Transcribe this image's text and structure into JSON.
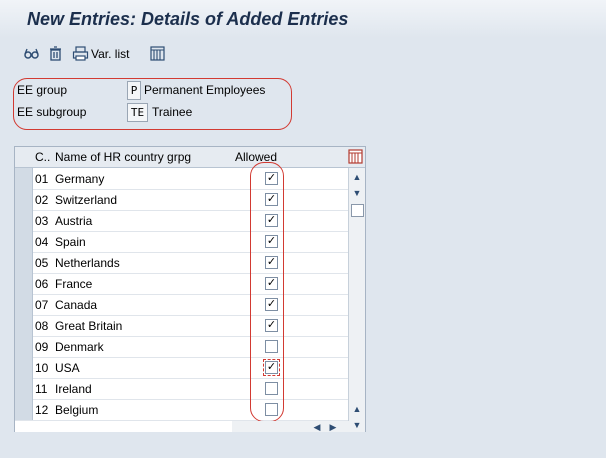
{
  "window": {
    "title": "New Entries: Details of Added Entries"
  },
  "toolbar": {
    "icons": [
      "glasses-icon",
      "trash-icon",
      "printer-icon",
      "table-settings-icon"
    ],
    "var_list_label": "Var. list"
  },
  "header": {
    "ee_group_label": "EE group",
    "ee_group_code": "P",
    "ee_group_text": "Permanent Employees",
    "ee_subgroup_label": "EE subgroup",
    "ee_subgroup_code": "TE",
    "ee_subgroup_text": "Trainee"
  },
  "table": {
    "columns": {
      "code": "C..",
      "name": "Name of HR country grpg",
      "allowed": "Allowed"
    },
    "rows": [
      {
        "code": "01",
        "name": "Germany",
        "allowed": true
      },
      {
        "code": "02",
        "name": "Switzerland",
        "allowed": true
      },
      {
        "code": "03",
        "name": "Austria",
        "allowed": true
      },
      {
        "code": "04",
        "name": "Spain",
        "allowed": true
      },
      {
        "code": "05",
        "name": "Netherlands",
        "allowed": true
      },
      {
        "code": "06",
        "name": "France",
        "allowed": true
      },
      {
        "code": "07",
        "name": "Canada",
        "allowed": true
      },
      {
        "code": "08",
        "name": "Great Britain",
        "allowed": true
      },
      {
        "code": "09",
        "name": "Denmark",
        "allowed": false
      },
      {
        "code": "10",
        "name": "USA",
        "allowed": true
      },
      {
        "code": "11",
        "name": "Ireland",
        "allowed": false
      },
      {
        "code": "12",
        "name": "Belgium",
        "allowed": false
      }
    ]
  },
  "colors": {
    "highlight_oval": "#d23a32",
    "title_text": "#1c2f4d"
  }
}
